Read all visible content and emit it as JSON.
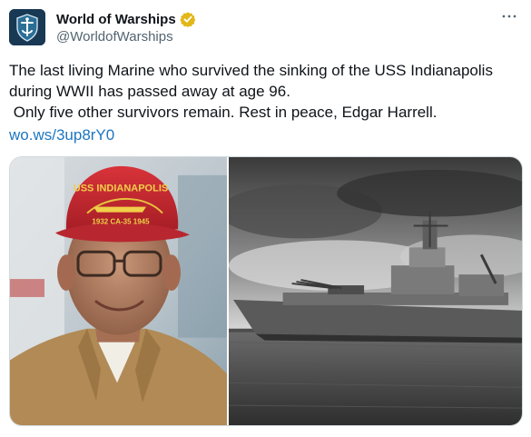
{
  "account": {
    "display_name": "World of Warships",
    "handle": "@WorldofWarships",
    "verified": true,
    "avatar_icon": "world-of-warships-logo-icon",
    "verified_icon": "verified-badge-icon",
    "verified_color": "#e2b719"
  },
  "menu": {
    "icon": "more-options-icon"
  },
  "tweet": {
    "line1": "The last living Marine who survived the sinking of the USS Indianapolis",
    "line2": "during WWII has passed away at age 96.",
    "line3": " Only five other survivors remain. Rest in peace, Edgar Harrell.",
    "link_text": "wo.ws/3up8rY0",
    "link_color": "#1d76c1"
  },
  "media": {
    "left_image": {
      "cap_text_top": "USS INDIANAPOLIS",
      "cap_text_bottom": "1932 CA-35 1945"
    },
    "right_image": {}
  }
}
